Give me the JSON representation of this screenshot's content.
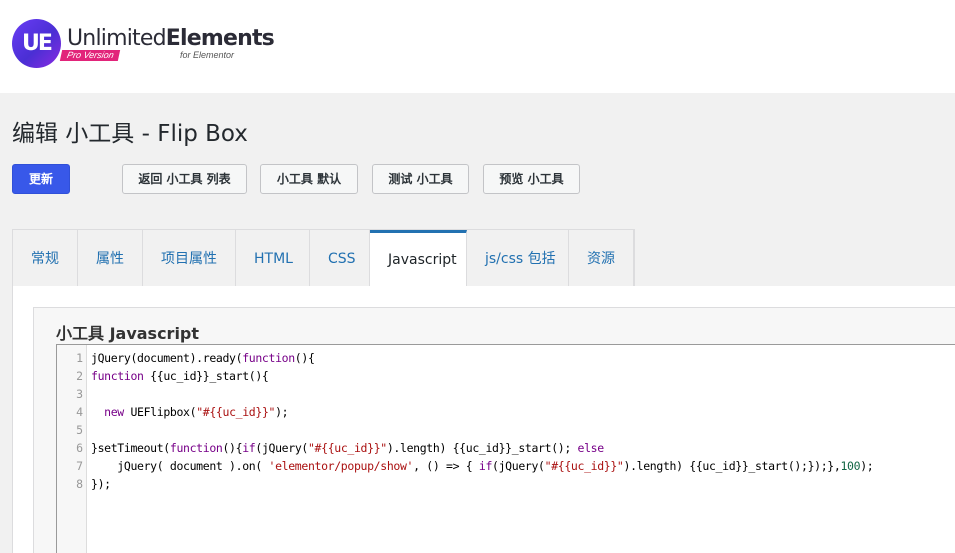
{
  "brand": {
    "name_light": "Unlimited",
    "name_bold": "Elements",
    "badge": "Pro Version",
    "tagline": "for Elementor",
    "logo_mark": "UE",
    "accent": "#6a3cf5"
  },
  "page_title": "编辑 小工具 - Flip Box",
  "buttons": {
    "update": "更新",
    "back_to_list": "返回 小工具 列表",
    "widget_defaults": "小工具 默认",
    "test_widget": "测试 小工具",
    "preview_widget": "预览 小工具"
  },
  "tabs": [
    {
      "label": "常规"
    },
    {
      "label": "属性"
    },
    {
      "label": "项目属性"
    },
    {
      "label": "HTML"
    },
    {
      "label": "CSS"
    },
    {
      "label": "Javascript",
      "active": true
    },
    {
      "label": "js/css 包括"
    },
    {
      "label": "资源"
    }
  ],
  "editor": {
    "title": "小工具 Javascript",
    "line_numbers": [
      "1",
      "2",
      "3",
      "4",
      "5",
      "6",
      "7",
      "8"
    ],
    "lines": [
      "jQuery(document).ready(function(){",
      "function {{uc_id}}_start(){",
      "",
      "  new UEFlipbox(\"#{{uc_id}}\");",
      "",
      "}setTimeout(function(){if(jQuery(\"#{{uc_id}}\").length) {{uc_id}}_start(); else",
      "    jQuery( document ).on( 'elementor/popup/show', () => { if(jQuery(\"#{{uc_id}}\").length) {{uc_id}}_start();});},100);",
      "});"
    ]
  }
}
